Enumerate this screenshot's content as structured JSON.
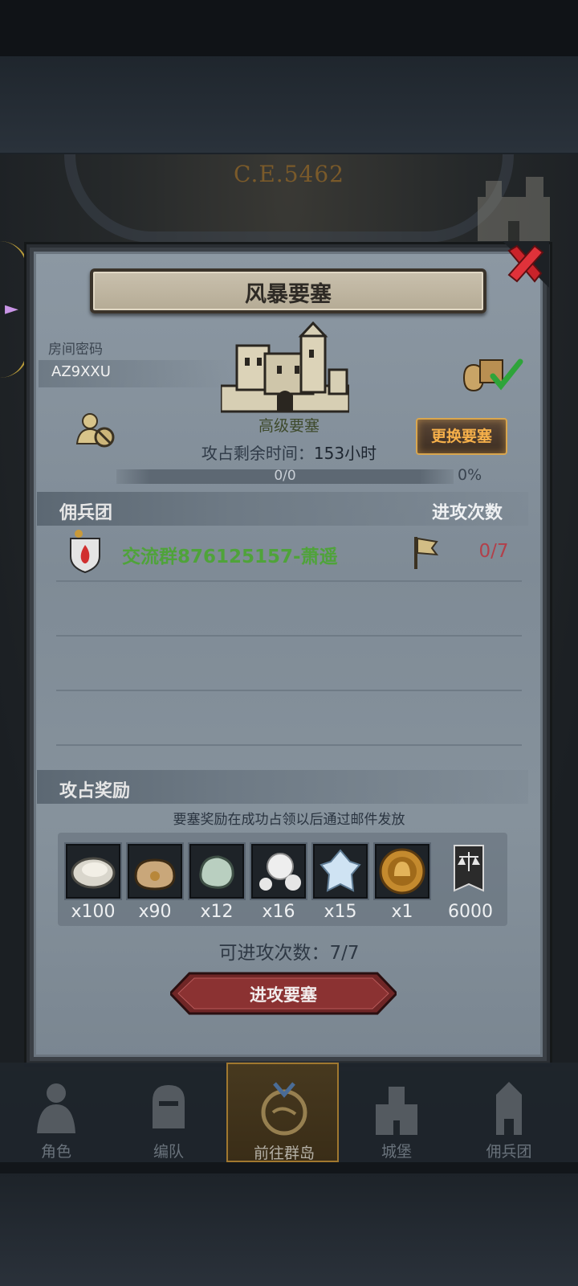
{
  "background": {
    "era": "C.E.5462"
  },
  "dialog": {
    "title": "风暴要塞"
  },
  "room": {
    "label": "房间密码",
    "code": "AZ9XXU"
  },
  "fortress": {
    "level": "高级要塞",
    "change_button": "更换要塞",
    "time_label": "攻占剩余时间：",
    "time_value": "153小时",
    "progress_text": "0/0",
    "progress_percent": "0%",
    "progress_fraction": 0
  },
  "mercenary": {
    "header": "佣兵团",
    "attack_header": "进攻次数",
    "guilds": [
      {
        "name": "交流群876125157-萧遥",
        "attacks": "0/7"
      }
    ]
  },
  "rewards": {
    "header": "攻占奖励",
    "note": "要塞奖励在成功占领以后通过邮件发放",
    "items": [
      {
        "icon": "oyster-icon",
        "qty": "x100"
      },
      {
        "icon": "coin-bag-icon",
        "qty": "x90"
      },
      {
        "icon": "jade-stone-icon",
        "qty": "x12"
      },
      {
        "icon": "pearl-icon",
        "qty": "x16"
      },
      {
        "icon": "ice-crystal-icon",
        "qty": "x15"
      },
      {
        "icon": "helmet-medal-icon",
        "qty": "x1"
      },
      {
        "icon": "justice-banner-icon",
        "qty": "6000"
      }
    ]
  },
  "attack": {
    "attempts_label": "可进攻次数：",
    "attempts_value": "7/7",
    "button": "进攻要塞"
  },
  "nav": [
    "角色",
    "编队",
    "前往群岛",
    "城堡",
    "佣兵团"
  ],
  "colors": {
    "guild_name": "#4fa33a",
    "attack_count": "#b2404a",
    "change_button_text": "#f6b04a",
    "attack_button": "#8b3232"
  }
}
